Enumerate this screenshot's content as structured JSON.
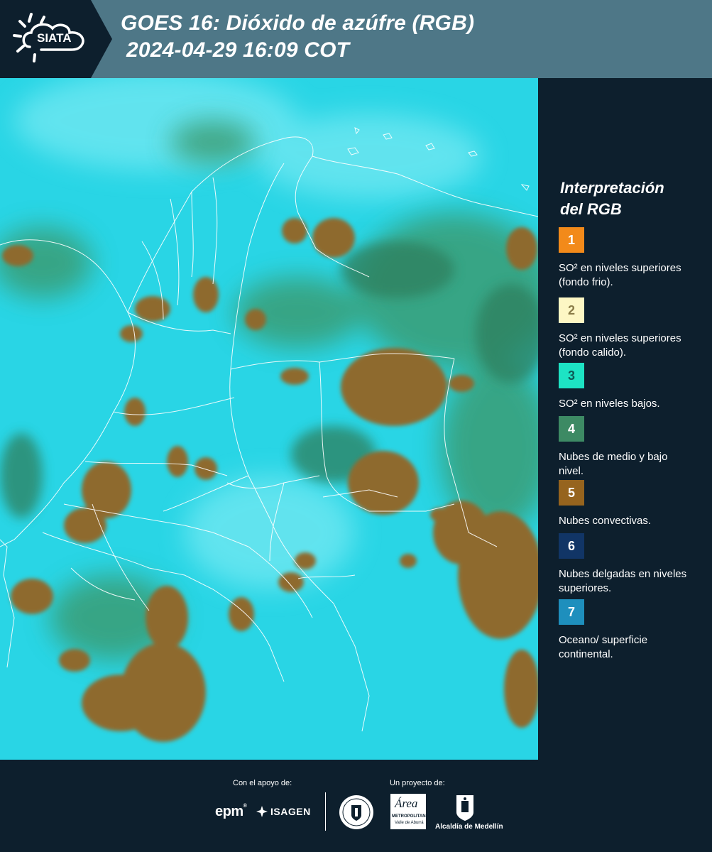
{
  "header": {
    "logo_text": "SIATA",
    "title_line1": "GOES 16: Dióxido de azúfre (RGB)",
    "title_line2": "2024-04-29 16:09 COT"
  },
  "map": {
    "image": "satellite-sulfur-dioxide-rgb-composite",
    "background_color": "#27d6e6"
  },
  "legend": {
    "title_line1": "Interpretación",
    "title_line2": "del RGB",
    "items": [
      {
        "number": "1",
        "color": "#f28a1a",
        "number_color": "#ffffff",
        "description": "SO² en niveles superiores (fondo frio)."
      },
      {
        "number": "2",
        "color": "#fdf7c4",
        "number_color": "#8a7c48",
        "description": "SO² en niveles superiores (fondo calido)."
      },
      {
        "number": "3",
        "color": "#1de3c4",
        "number_color": "#0e5b57",
        "description": "SO² en niveles bajos."
      },
      {
        "number": "4",
        "color": "#3d8a64",
        "number_color": "#ffffff",
        "description": "Nubes de medio y bajo nivel."
      },
      {
        "number": "5",
        "color": "#96641e",
        "number_color": "#ffffff",
        "description": "Nubes convectivas."
      },
      {
        "number": "6",
        "color": "#113566",
        "number_color": "#ffffff",
        "description": "Nubes delgadas en niveles superiores."
      },
      {
        "number": "7",
        "color": "#1e8fbd",
        "number_color": "#ffffff",
        "description": "Oceano/ superficie continental."
      }
    ]
  },
  "footer": {
    "support_label": "Con el apoyo de:",
    "project_label": "Un proyecto de:",
    "epm": "epm",
    "isagen": "ISAGEN",
    "area_line1": "Área",
    "area_line2": "METROPOLITANA",
    "area_line3": "Valle de Aburrá",
    "alcaldia": "Alcaldía de Medellín"
  }
}
